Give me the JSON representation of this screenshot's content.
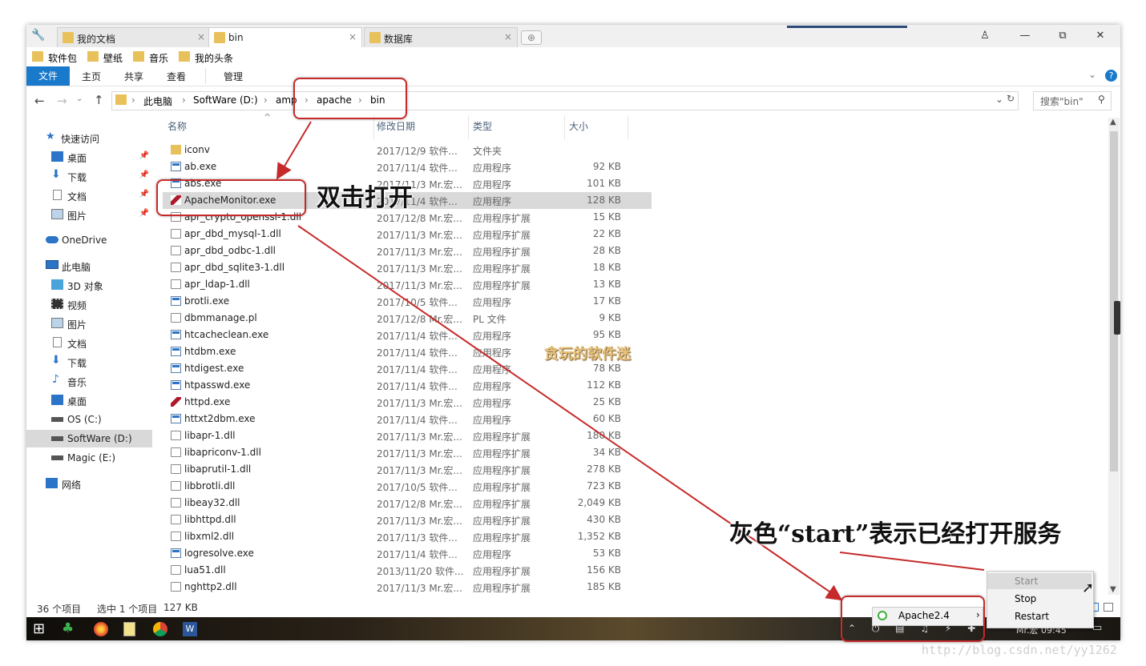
{
  "tabs": [
    {
      "label": "我的文档",
      "close": "×"
    },
    {
      "label": "bin",
      "close": "×"
    },
    {
      "label": "数据库",
      "close": "×"
    }
  ],
  "window_controls": {
    "user": "♙",
    "minimize": "—",
    "restore": "⧉",
    "close": "✕"
  },
  "favorites": [
    "软件包",
    "壁纸",
    "音乐",
    "我的头条"
  ],
  "ribbon": {
    "file": "文件",
    "home": "主页",
    "share": "共享",
    "view": "查看",
    "manage": "管理"
  },
  "address": {
    "crumbs": [
      "此电脑",
      "SoftWare (D:)",
      "amp",
      "apache",
      "bin"
    ],
    "search_placeholder": "搜索\"bin\""
  },
  "sidebar": {
    "quick": "快速访问",
    "quick_items": [
      "桌面",
      "下载",
      "文档",
      "图片"
    ],
    "onedrive": "OneDrive",
    "thispc": "此电脑",
    "pc_items": [
      "3D 对象",
      "视频",
      "图片",
      "文档",
      "下载",
      "音乐",
      "桌面",
      "OS (C:)",
      "SoftWare (D:)",
      "Magic (E:)"
    ],
    "network": "网络"
  },
  "columns": {
    "name": "名称",
    "date": "修改日期",
    "type": "类型",
    "size": "大小"
  },
  "files": [
    {
      "name": "iconv",
      "date": "2017/12/9 软件...",
      "type": "文件夹",
      "size": "",
      "icon": "folder"
    },
    {
      "name": "ab.exe",
      "date": "2017/11/4 软件...",
      "type": "应用程序",
      "size": "92 KB",
      "icon": "exe"
    },
    {
      "name": "abs.exe",
      "date": "2017/11/3 Mr.宏...",
      "type": "应用程序",
      "size": "101 KB",
      "icon": "exe"
    },
    {
      "name": "ApacheMonitor.exe",
      "date": "2017/11/4 软件...",
      "type": "应用程序",
      "size": "128 KB",
      "icon": "feather"
    },
    {
      "name": "apr_crypto_openssl-1.dll",
      "date": "2017/12/8 Mr.宏...",
      "type": "应用程序扩展",
      "size": "15 KB",
      "icon": "dll"
    },
    {
      "name": "apr_dbd_mysql-1.dll",
      "date": "2017/11/3 Mr.宏...",
      "type": "应用程序扩展",
      "size": "22 KB",
      "icon": "dll"
    },
    {
      "name": "apr_dbd_odbc-1.dll",
      "date": "2017/11/3 Mr.宏...",
      "type": "应用程序扩展",
      "size": "28 KB",
      "icon": "dll"
    },
    {
      "name": "apr_dbd_sqlite3-1.dll",
      "date": "2017/11/3 Mr.宏...",
      "type": "应用程序扩展",
      "size": "18 KB",
      "icon": "dll"
    },
    {
      "name": "apr_ldap-1.dll",
      "date": "2017/11/3 Mr.宏...",
      "type": "应用程序扩展",
      "size": "13 KB",
      "icon": "dll"
    },
    {
      "name": "brotli.exe",
      "date": "2017/10/5 软件...",
      "type": "应用程序",
      "size": "17 KB",
      "icon": "exe"
    },
    {
      "name": "dbmmanage.pl",
      "date": "2017/12/8 Mr.宏...",
      "type": "PL 文件",
      "size": "9 KB",
      "icon": "dll"
    },
    {
      "name": "htcacheclean.exe",
      "date": "2017/11/4 软件...",
      "type": "应用程序",
      "size": "95 KB",
      "icon": "exe"
    },
    {
      "name": "htdbm.exe",
      "date": "2017/11/4 软件...",
      "type": "应用程序",
      "size": "",
      "icon": "exe"
    },
    {
      "name": "htdigest.exe",
      "date": "2017/11/4 软件...",
      "type": "应用程序",
      "size": "78 KB",
      "icon": "exe"
    },
    {
      "name": "htpasswd.exe",
      "date": "2017/11/4 软件...",
      "type": "应用程序",
      "size": "112 KB",
      "icon": "exe"
    },
    {
      "name": "httpd.exe",
      "date": "2017/11/3 Mr.宏...",
      "type": "应用程序",
      "size": "25 KB",
      "icon": "feather"
    },
    {
      "name": "httxt2dbm.exe",
      "date": "2017/11/4 软件...",
      "type": "应用程序",
      "size": "60 KB",
      "icon": "exe"
    },
    {
      "name": "libapr-1.dll",
      "date": "2017/11/3 Mr.宏...",
      "type": "应用程序扩展",
      "size": "180 KB",
      "icon": "dll"
    },
    {
      "name": "libapriconv-1.dll",
      "date": "2017/11/3 Mr.宏...",
      "type": "应用程序扩展",
      "size": "34 KB",
      "icon": "dll"
    },
    {
      "name": "libaprutil-1.dll",
      "date": "2017/11/3 Mr.宏...",
      "type": "应用程序扩展",
      "size": "278 KB",
      "icon": "dll"
    },
    {
      "name": "libbrotli.dll",
      "date": "2017/10/5 软件...",
      "type": "应用程序扩展",
      "size": "723 KB",
      "icon": "dll"
    },
    {
      "name": "libeay32.dll",
      "date": "2017/12/8 Mr.宏...",
      "type": "应用程序扩展",
      "size": "2,049 KB",
      "icon": "dll"
    },
    {
      "name": "libhttpd.dll",
      "date": "2017/11/3 Mr.宏...",
      "type": "应用程序扩展",
      "size": "430 KB",
      "icon": "dll"
    },
    {
      "name": "libxml2.dll",
      "date": "2017/11/3 软件...",
      "type": "应用程序扩展",
      "size": "1,352 KB",
      "icon": "dll"
    },
    {
      "name": "logresolve.exe",
      "date": "2017/11/4 软件...",
      "type": "应用程序",
      "size": "53 KB",
      "icon": "exe"
    },
    {
      "name": "lua51.dll",
      "date": "2013/11/20 软件...",
      "type": "应用程序扩展",
      "size": "156 KB",
      "icon": "dll"
    },
    {
      "name": "nghttp2.dll",
      "date": "2017/11/3 Mr.宏...",
      "type": "应用程序扩展",
      "size": "185 KB",
      "icon": "dll"
    }
  ],
  "status": {
    "count": "36 个项目",
    "selected": "选中 1 个项目",
    "size": "127 KB"
  },
  "annotations": {
    "double_click": "双击打开",
    "gray_start": "灰色“start”表示已经打开服务"
  },
  "context_menu": {
    "start": "Start",
    "stop": "Stop",
    "restart": "Restart"
  },
  "tray_menu": {
    "service": "Apache2.4",
    "arrow": "›"
  },
  "watermark": "贪玩的软件迷",
  "credit": "http://blog.csdn.net/yy1262",
  "colors": {
    "accent": "#1979ca",
    "annotation_red": "#c62a2a",
    "selection": "#d9d9d9"
  }
}
